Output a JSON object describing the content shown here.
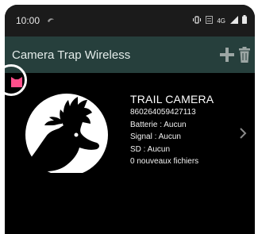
{
  "status_bar": {
    "time": "10:00",
    "network": "4G"
  },
  "app_bar": {
    "title": "Camera Trap Wireless"
  },
  "cameras": [
    {
      "name": "TRAIL CAMERA",
      "id": "860264059427113",
      "battery": "Batterie : Aucun",
      "signal": "Signal : Aucun",
      "sd": "SD : Aucun",
      "new_files": "0 nouveaux fichiers"
    }
  ],
  "colors": {
    "app_bar": "#263f3c",
    "status_bar": "#1b1b1b",
    "background": "#000000",
    "tag": "#ff4f8b"
  },
  "icons": {
    "add": "plus-icon",
    "delete": "trash-icon",
    "tag": "tag-icon",
    "chevron": "chevron-right-icon",
    "logo": "deer-head-logo"
  }
}
